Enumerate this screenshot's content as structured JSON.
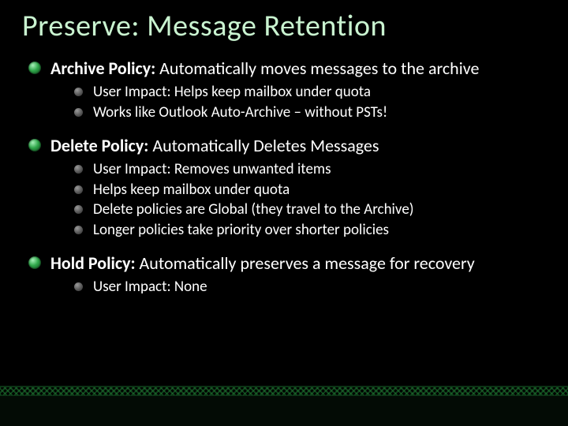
{
  "title": "Preserve: Message Retention",
  "sections": [
    {
      "label": "Archive Policy:",
      "desc": " Automatically moves messages to the archive",
      "items": [
        "User Impact: Helps keep mailbox under quota",
        "Works like Outlook Auto-Archive – without PSTs!"
      ]
    },
    {
      "label": "Delete Policy:",
      "desc": " Automatically Deletes Messages",
      "items": [
        "User Impact: Removes unwanted items",
        "Helps keep mailbox under quota",
        "Delete policies are Global (they travel to the Archive)",
        "Longer policies take priority over shorter policies"
      ]
    },
    {
      "label": "Hold Policy:",
      "desc": " Automatically preserves a message for recovery",
      "items": [
        "User Impact: None"
      ]
    }
  ]
}
